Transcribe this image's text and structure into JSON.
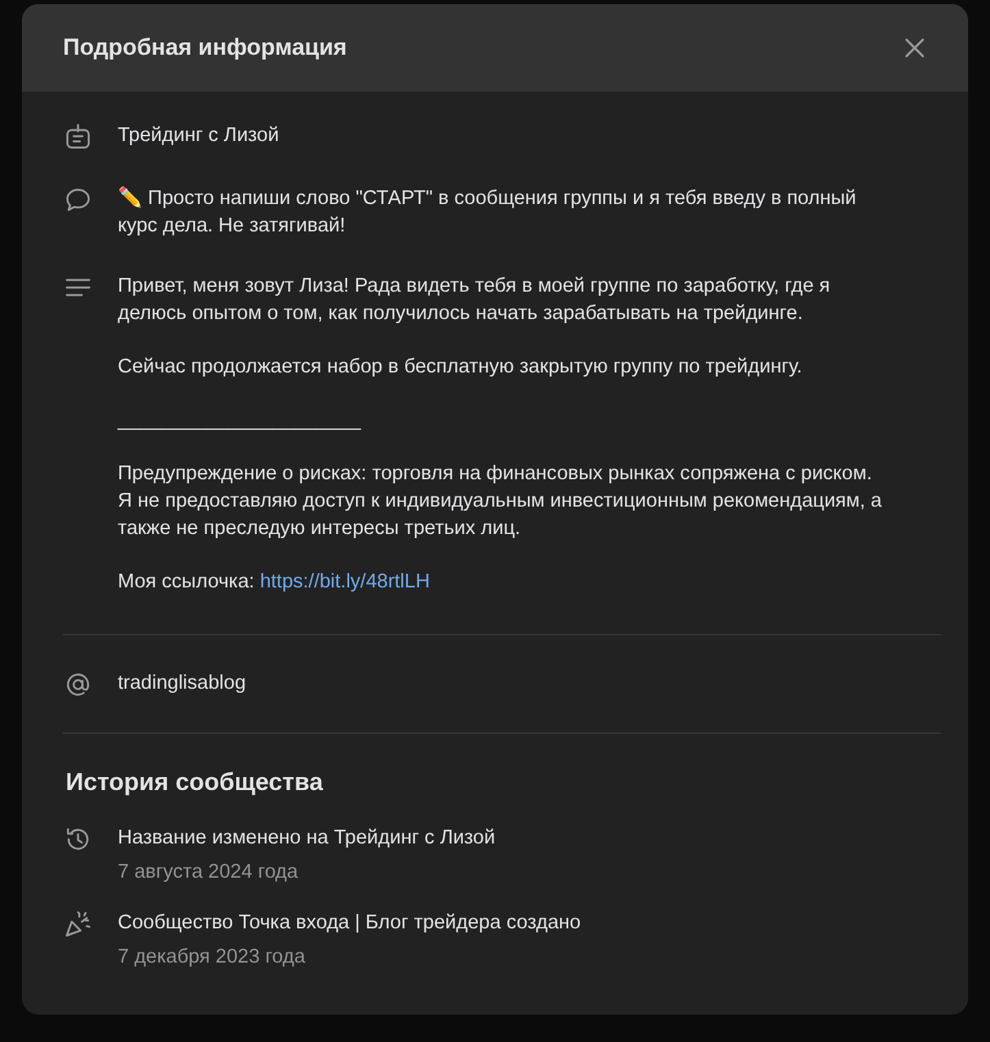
{
  "dialog": {
    "title": "Подробная информация",
    "info": [
      {
        "kind": "name",
        "text": "Трейдинг с Лизой"
      },
      {
        "kind": "status",
        "text": "✏️ Просто напиши слово \"СТАРТ\" в сообщения группы и я тебя введу в полный курс дела. Не затягивай!"
      },
      {
        "kind": "description",
        "paragraphs": [
          "Привет, меня зовут Лиза! Рада видеть тебя в моей группе по заработку, где я делюсь опытом о том, как получилось начать зарабатывать на трейдинге.",
          "Сейчас продолжается набор в бесплатную закрытую группу по трейдингу.",
          "______________________",
          "Предупреждение о рисках: торговля на финансовых рынках сопряжена с риском. Я не предоставляю доступ к индивидуальным инвестиционным рекомендациям, а также не преследую интересы третьих лиц."
        ],
        "link_label": "Моя ссылочка:",
        "link": "https://bit.ly/48rtlLH"
      }
    ],
    "address": {
      "kind": "screen_name",
      "text": "tradinglisablog"
    },
    "history": {
      "title": "История сообщества",
      "events": [
        {
          "kind": "rename",
          "text": "Название изменено на Трейдинг с Лизой",
          "date": "7 августа 2024 года"
        },
        {
          "kind": "created",
          "text": "Сообщество Точка входа | Блог трейдера создано",
          "date": "7 декабря 2023 года"
        }
      ]
    }
  }
}
